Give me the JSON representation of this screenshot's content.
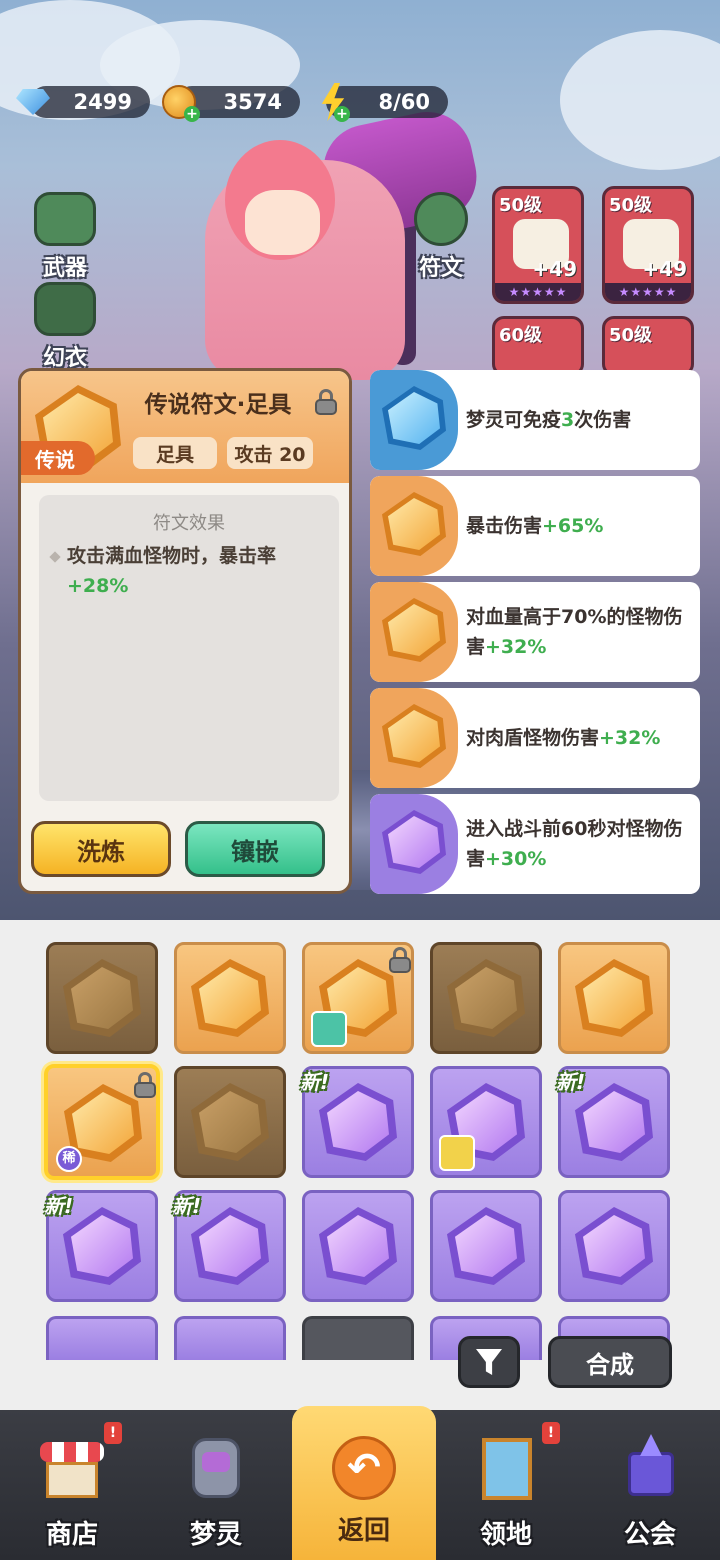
{
  "currency": {
    "gems": "2499",
    "coins": "3574",
    "energy": "8/60"
  },
  "side_menu": {
    "weapon_label": "武器",
    "outfit_label": "幻衣",
    "rune_label": "符文"
  },
  "equipment": [
    {
      "level": "50级",
      "plus": "+49"
    },
    {
      "level": "50级",
      "plus": "+49"
    },
    {
      "level": "60级",
      "plus": ""
    },
    {
      "level": "50级",
      "plus": ""
    }
  ],
  "detail": {
    "title": "传说符文·足具",
    "rarity": "传说",
    "slot_tag": "足具",
    "stat_tag": "攻击 20",
    "effect_title": "符文效果",
    "effect_text_main": "攻击满血怪物时，暴击率",
    "effect_text_value": "+28%",
    "refine_button": "洗炼",
    "inlay_button": "镶嵌"
  },
  "attributes": [
    {
      "prefix": "梦灵可免疫",
      "highlight": "3",
      "suffix": "次伤害",
      "color": "blue"
    },
    {
      "prefix": "暴击伤害",
      "highlight": "+65%",
      "suffix": "",
      "color": "gold"
    },
    {
      "prefix": "对血量高于70%的怪物伤害",
      "highlight": "+32%",
      "suffix": "",
      "color": "gold"
    },
    {
      "prefix": "对肉盾怪物伤害",
      "highlight": "+32%",
      "suffix": "",
      "color": "gold"
    },
    {
      "prefix": "进入战斗前60秒对怪物伤害",
      "highlight": "+30%",
      "suffix": "",
      "color": "purple"
    }
  ],
  "inventory": {
    "new_badge": "新!",
    "rare_badge": "稀",
    "merge_button": "合成"
  },
  "nav": {
    "shop": "商店",
    "spirit": "梦灵",
    "back": "返回",
    "territory": "领地",
    "guild": "公会",
    "shop_badge": "!",
    "territory_badge": "!"
  },
  "colors": {
    "legend_gold": "#f0a55c",
    "epic_purple": "#9b7fe2",
    "highlight_green": "#3fae4f",
    "accent_blue": "#3c8fe0"
  }
}
